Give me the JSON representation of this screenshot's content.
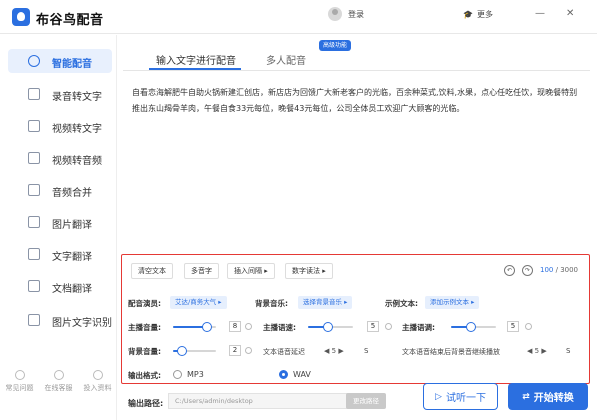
{
  "app": {
    "title": "布谷鸟配音"
  },
  "header": {
    "login": "登录",
    "more": "更多"
  },
  "sidebar": {
    "items": [
      {
        "label": "智能配音",
        "active": true
      },
      {
        "label": "录音转文字"
      },
      {
        "label": "视频转文字"
      },
      {
        "label": "视频转音频"
      },
      {
        "label": "音频合并"
      },
      {
        "label": "图片翻译"
      },
      {
        "label": "文字翻译"
      },
      {
        "label": "文档翻译"
      },
      {
        "label": "图片文字识别"
      }
    ],
    "bottom": [
      "常见问题",
      "在线客服",
      "投入资料"
    ]
  },
  "tabs": {
    "active": "输入文字进行配音",
    "other": "多人配音",
    "badge": "高级功能"
  },
  "content": {
    "text": "自看恋海解肥牛自助火锅新建汇创店，新店店为回馈广大新老客户的光临，百余种菜式,饮料,水果，点心任吃任饮，现晚餐特别推出东山羯骨羊肉，午餐自食33元每位，晚餐43元每位，公司全体员工欢迎广大顾客的光临。"
  },
  "toolbar": {
    "clear": "清空文本",
    "polyphone": "多音字",
    "pause": "插入间隔 ▸",
    "digit": "数字读法 ▸",
    "count_current": "100",
    "count_max": "/ 3000"
  },
  "settings": {
    "speaker_label": "配音演员:",
    "speaker_value": "艾达/商务大气 ▸",
    "bgm_label": "背景音乐:",
    "bgm_value": "选择背景音乐 ▸",
    "example_label": "示例文本:",
    "example_value": "添加示例文本 ▸",
    "volume_label": "主播音量:",
    "volume_value": "8",
    "volume_fraction": 0.8,
    "speed_label": "主播语速:",
    "speed_value": "5",
    "speed_fraction": 0.45,
    "pitch_label": "主播语调:",
    "pitch_value": "5",
    "pitch_fraction": 0.45,
    "bg_volume_label": "背景音量:",
    "bg_volume_value": "2",
    "bg_volume_fraction": 0.2,
    "delay_label": "文本语音延迟",
    "delay_value": "5",
    "delay_unit": "S",
    "end_label": "文本语音结束后背景音继续播放",
    "end_value": "5",
    "end_unit": "S",
    "format_label": "输出格式:",
    "format_mp3": "MP3",
    "format_wav": "WAV"
  },
  "footer": {
    "out_label": "输出路径:",
    "path_value": "C:/Users/admin/desktop",
    "path_button": "更改路径",
    "listen_button": "试听一下",
    "convert_button": "开始转换"
  },
  "colors": {
    "accent": "#2b6fe0",
    "panel_border": "#e53935"
  }
}
